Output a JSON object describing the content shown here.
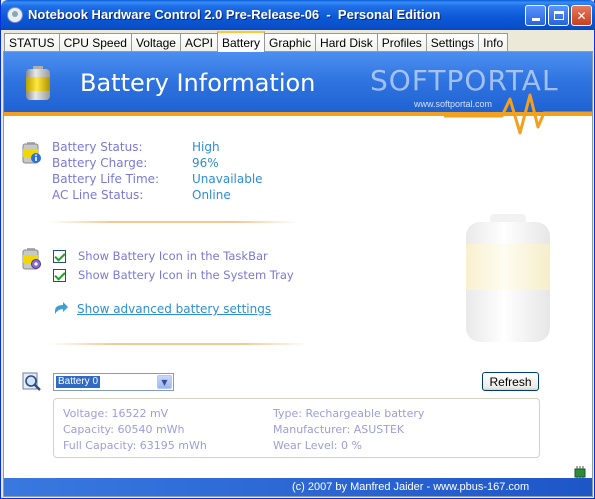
{
  "window": {
    "title": "Notebook Hardware Control 2.0 Pre-Release-06  -  Personal Edition"
  },
  "tabs": [
    {
      "label": "STATUS",
      "active": false
    },
    {
      "label": "CPU Speed",
      "active": false
    },
    {
      "label": "Voltage",
      "active": false
    },
    {
      "label": "ACPI",
      "active": false
    },
    {
      "label": "Battery",
      "active": true
    },
    {
      "label": "Graphic",
      "active": false
    },
    {
      "label": "Hard Disk",
      "active": false
    },
    {
      "label": "Profiles",
      "active": false
    },
    {
      "label": "Settings",
      "active": false
    },
    {
      "label": "Info",
      "active": false
    }
  ],
  "header": {
    "title": "Battery Information",
    "watermark_logo": "SOFTPORTAL",
    "watermark_url": "www.softportal.com"
  },
  "battery_info": [
    {
      "label": "Battery Status:",
      "value": "High"
    },
    {
      "label": "Battery Charge:",
      "value": "96%"
    },
    {
      "label": "Battery Life Time:",
      "value": "Unavailable"
    },
    {
      "label": "AC Line Status:",
      "value": "Online"
    }
  ],
  "options": {
    "taskbar_icon": {
      "label": "Show Battery Icon in the TaskBar",
      "checked": true
    },
    "tray_icon": {
      "label": "Show Battery Icon in the System Tray",
      "checked": true
    },
    "advanced_link": "Show advanced battery settings"
  },
  "battery_select": {
    "selected": "Battery 0",
    "refresh_label": "Refresh"
  },
  "details": {
    "voltage": "Voltage:  16522 mV",
    "capacity": "Capacity:  60540 mWh",
    "full_capacity": "Full Capacity:  63195 mWh",
    "type": "Type:  Rechargeable battery",
    "manufacturer": "Manufacturer:  ASUSTEK",
    "wear_level": "Wear Level:  0 %"
  },
  "footer": {
    "credit": "(c) 2007 by Manfred Jaider - www.pbus-167.com"
  },
  "colors": {
    "label": "#7a78d8",
    "value": "#2c8ed4",
    "banner": "#2f74e0",
    "accent_stripe": "#f2a020"
  }
}
